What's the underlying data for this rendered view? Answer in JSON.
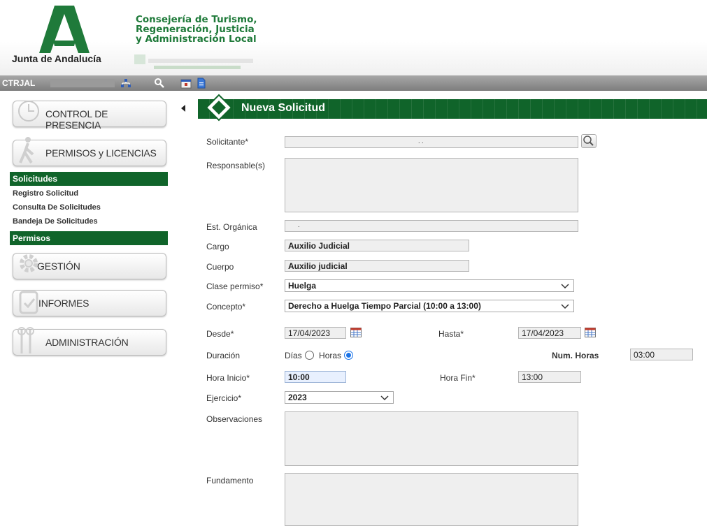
{
  "header": {
    "logo_text": "Junta de Andalucía",
    "consejeria_lines": [
      "Consejería de Turismo,",
      "Regeneración, Justicia",
      "y Administración Local"
    ],
    "brand_color": "#10642a"
  },
  "toolbar": {
    "user_code": "CTRJAL",
    "icons": [
      "network-icon",
      "search-icon",
      "calendar-icon",
      "document-icon"
    ]
  },
  "sidebar": {
    "buttons": {
      "control": "CONTROL DE PRESENCIA",
      "permisos": "PERMISOS y LICENCIAS",
      "gestion": "GESTIÓN",
      "informes": "INFORMES",
      "administracion": "ADMINISTRACIÓN"
    },
    "solicitudes_header": "Solicitudes",
    "solicitudes_items": [
      "Registro Solicitud",
      "Consulta De Solicitudes",
      "Bandeja De Solicitudes"
    ],
    "permisos_header": "Permisos"
  },
  "form": {
    "title": "Nueva Solicitud",
    "labels": {
      "solicitante": "Solicitante*",
      "responsables": "Responsable(s)",
      "est_organica": "Est. Orgánica",
      "cargo": "Cargo",
      "cuerpo": "Cuerpo",
      "clase_permiso": "Clase permiso*",
      "concepto": "Concepto*",
      "desde": "Desde*",
      "hasta": "Hasta*",
      "duracion": "Duración",
      "num_horas": "Num. Horas",
      "hora_inicio": "Hora Inicio*",
      "hora_fin": "Hora Fin*",
      "ejercicio": "Ejercicio*",
      "observaciones": "Observaciones",
      "fundamento": "Fundamento"
    },
    "values": {
      "solicitante": ". .",
      "est_organica": ".",
      "cargo": "Auxilio Judicial",
      "cuerpo": "Auxilio judicial",
      "clase_permiso": "Huelga",
      "concepto": "Derecho a Huelga Tiempo Parcial (10:00 a 13:00)",
      "desde": "17/04/2023",
      "hasta": "17/04/2023",
      "num_horas": "03:00",
      "hora_inicio": "10:00",
      "hora_fin": "13:00",
      "ejercicio": "2023"
    },
    "duracion_options": {
      "dias": "Días",
      "horas": "Horas",
      "selected": "horas"
    }
  }
}
